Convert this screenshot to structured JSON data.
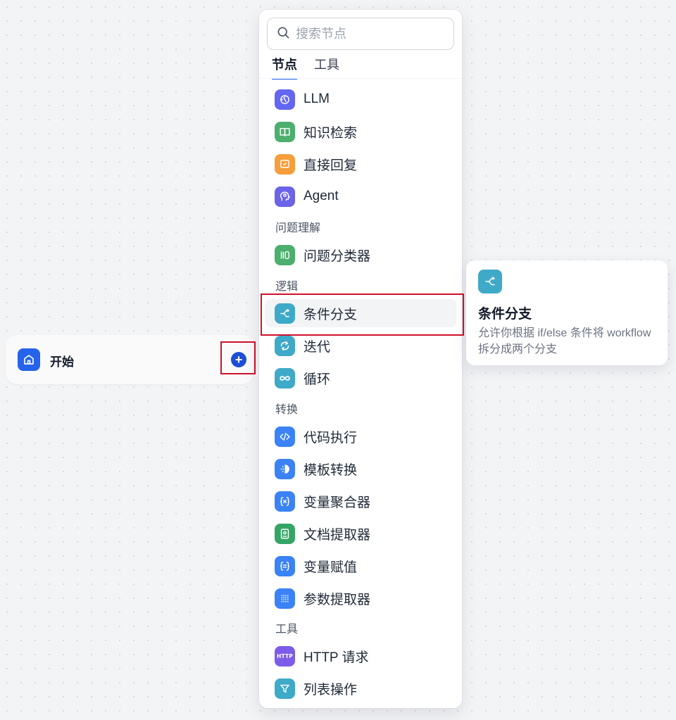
{
  "start_node": {
    "title": "开始"
  },
  "add_button": {
    "glyph": "+"
  },
  "panel": {
    "search": {
      "placeholder": "搜索节点",
      "value": ""
    },
    "tabs": [
      {
        "label": "节点",
        "active": true
      },
      {
        "label": "工具",
        "active": false
      }
    ],
    "items": {
      "llm": "LLM",
      "knowledge": "知识检索",
      "answer": "直接回复",
      "agent": "Agent",
      "classifier": "问题分类器",
      "ifelse": "条件分支",
      "iteration": "迭代",
      "loop": "循环",
      "code": "代码执行",
      "template": "模板转换",
      "aggregator": "变量聚合器",
      "doc": "文档提取器",
      "assign": "变量赋值",
      "param": "参数提取器",
      "http": "HTTP 请求",
      "listop": "列表操作"
    },
    "sections": {
      "question": "问题理解",
      "logic": "逻辑",
      "transform": "转换",
      "tools": "工具"
    },
    "http_badge": "HTTP"
  },
  "tooltip": {
    "title": "条件分支",
    "description": "允许你根据 if/else 条件将 workflow 拆分成两个分支"
  },
  "colors": {
    "primary": "#2563eb",
    "llm": "#6366f1",
    "knowledge": "#4caf6d",
    "answer": "#f59e3b",
    "agent": "#6b63e8",
    "teal": "#3fa9c8",
    "blue": "#3b82f6",
    "green": "#34a565",
    "http": "#7c5ce8",
    "highlight": "#d0112b"
  }
}
